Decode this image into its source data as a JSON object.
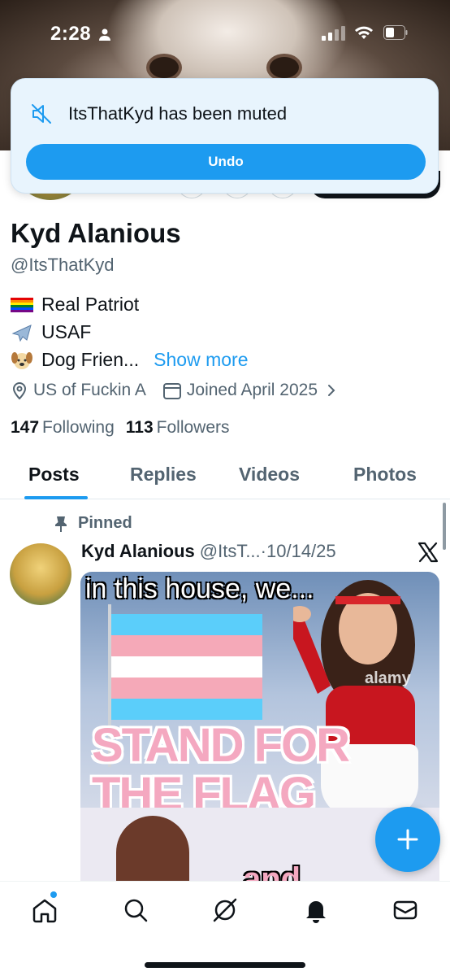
{
  "status_bar": {
    "time": "2:28"
  },
  "toast": {
    "message": "ItsThatKyd has been muted",
    "undo_label": "Undo"
  },
  "profile": {
    "name": "Kyd Alanious",
    "handle": "@ItsThatKyd",
    "bio": [
      {
        "emoji": "rainbow-flag",
        "text": "Real Patriot"
      },
      {
        "emoji": "airplane",
        "text": "USAF"
      },
      {
        "emoji": "dog-face",
        "text": "Dog Frien...",
        "more": "Show more"
      }
    ],
    "location": "US of Fuckin A",
    "joined": "Joined April 2025",
    "following_count": "147",
    "following_label": "Following",
    "followers_count": "113",
    "followers_label": "Followers"
  },
  "tabs": [
    "Posts",
    "Replies",
    "Videos",
    "Photos"
  ],
  "active_tab": "Posts",
  "post": {
    "pinned_label": "Pinned",
    "author_name": "Kyd Alanious",
    "author_handle": "@ItsT...",
    "date": "·10/14/25",
    "image": {
      "caption": "in this house, we...",
      "line1": "STAND FOR",
      "line2": "THE FLAG",
      "watermark": "alamy",
      "bottom_text": "and"
    }
  },
  "colors": {
    "accent": "#1d9bf0",
    "text": "#0f1419",
    "secondary": "#536471",
    "toast_bg": "#e8f4fd"
  },
  "bottom_nav": [
    "home-icon",
    "search-icon",
    "grok-icon",
    "notifications-icon",
    "messages-icon"
  ]
}
